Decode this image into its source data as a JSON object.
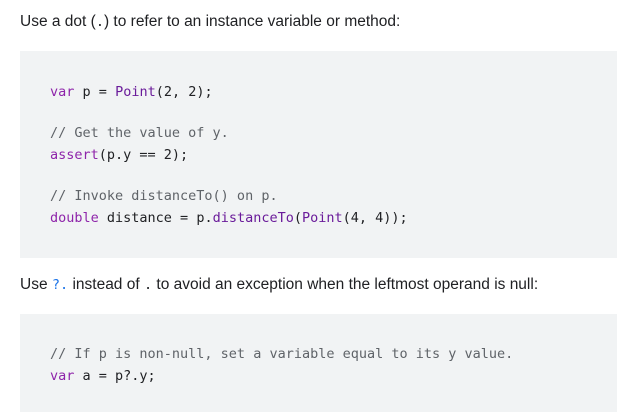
{
  "para1": {
    "before": "Use a dot (",
    "code": ".",
    "after": ") to refer to an instance variable or method:"
  },
  "code1": {
    "line1": {
      "kw": "var",
      "sp1": " p ",
      "op": "=",
      "sp2": " ",
      "fn": "Point",
      "args": "(2, 2);"
    },
    "line2": "// Get the value of y.",
    "line3": {
      "fn": "assert",
      "rest": "(p.y == 2);"
    },
    "line4": "// Invoke distanceTo() on p.",
    "line5": {
      "typ": "double",
      "mid": " distance = p.",
      "fn": "distanceTo",
      "p1": "(",
      "fn2": "Point",
      "args": "(4, 4));"
    }
  },
  "para2": {
    "before": "Use ",
    "code1": "?.",
    "mid": " instead of ",
    "code2": ".",
    "after": " to avoid an exception when the leftmost operand is null:"
  },
  "code2": {
    "line1": "// If p is non-null, set a variable equal to its y value.",
    "line2": {
      "kw": "var",
      "rest": " a = p?.y;"
    }
  }
}
